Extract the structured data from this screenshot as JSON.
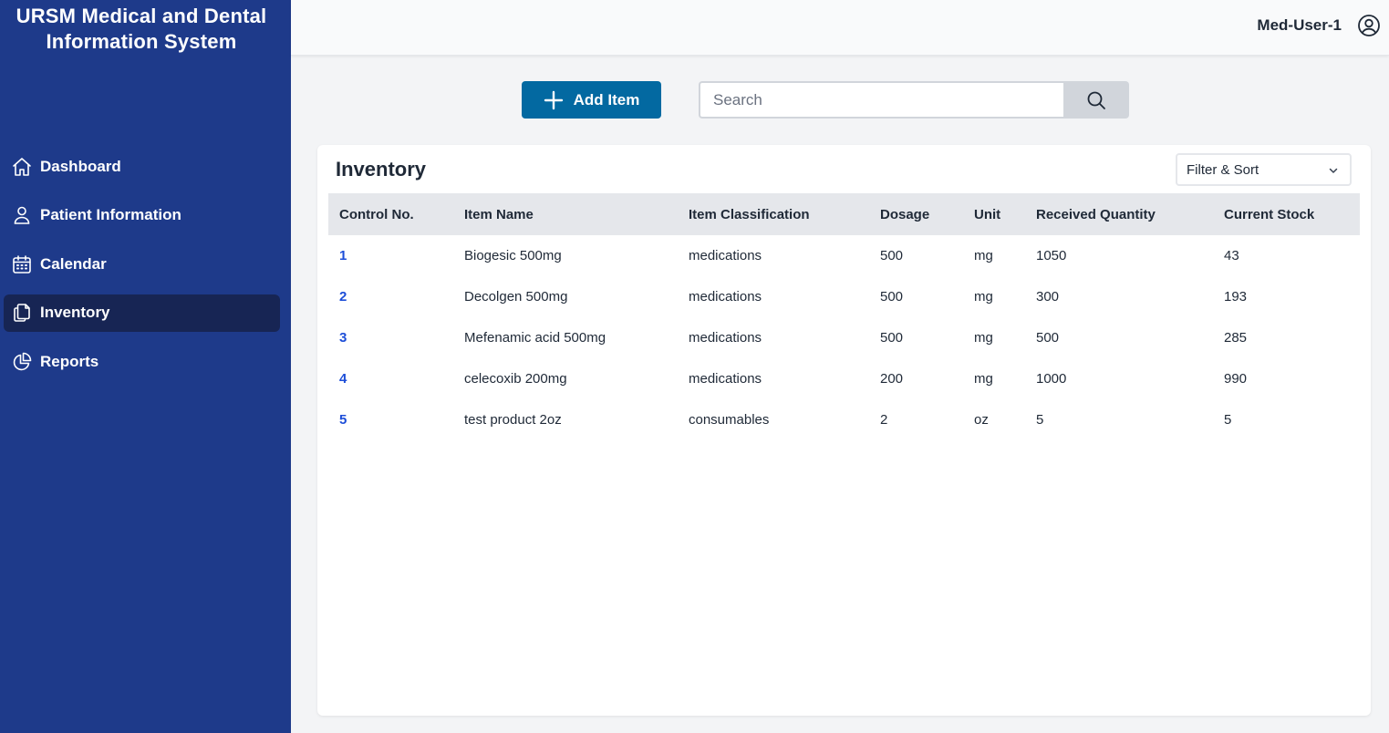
{
  "app": {
    "title_line1": "URSM Medical and Dental",
    "title_line2": "Information System"
  },
  "sidebar": {
    "items": [
      {
        "label": "Dashboard",
        "icon": "home-icon"
      },
      {
        "label": "Patient Information",
        "icon": "user-icon"
      },
      {
        "label": "Calendar",
        "icon": "calendar-icon"
      },
      {
        "label": "Inventory",
        "icon": "documents-icon",
        "active": true
      },
      {
        "label": "Reports",
        "icon": "pie-chart-icon"
      }
    ]
  },
  "header": {
    "user_name": "Med-User-1",
    "user_icon": "user-circle-icon"
  },
  "toolbar": {
    "add_label": "Add Item",
    "add_icon": "plus-icon",
    "search_placeholder": "Search",
    "search_value": "",
    "search_icon": "search-icon"
  },
  "inventory": {
    "title": "Inventory",
    "filter_label": "Filter & Sort",
    "columns": [
      "Control No.",
      "Item Name",
      "Item Classification",
      "Dosage",
      "Unit",
      "Received Quantity",
      "Current Stock"
    ],
    "rows": [
      [
        "1",
        "Biogesic 500mg",
        "medications",
        "500",
        "mg",
        "1050",
        "43"
      ],
      [
        "2",
        "Decolgen 500mg",
        "medications",
        "500",
        "mg",
        "300",
        "193"
      ],
      [
        "3",
        "Mefenamic acid 500mg",
        "medications",
        "500",
        "mg",
        "500",
        "285"
      ],
      [
        "4",
        "celecoxib 200mg",
        "medications",
        "200",
        "mg",
        "1000",
        "990"
      ],
      [
        "5",
        "test product 2oz",
        "consumables",
        "2",
        "oz",
        "5",
        "5"
      ]
    ]
  },
  "colors": {
    "sidebar_bg": "#1e3a8a",
    "sidebar_active": "#172554",
    "primary_button": "#0369a1",
    "link": "#1d4ed8"
  }
}
